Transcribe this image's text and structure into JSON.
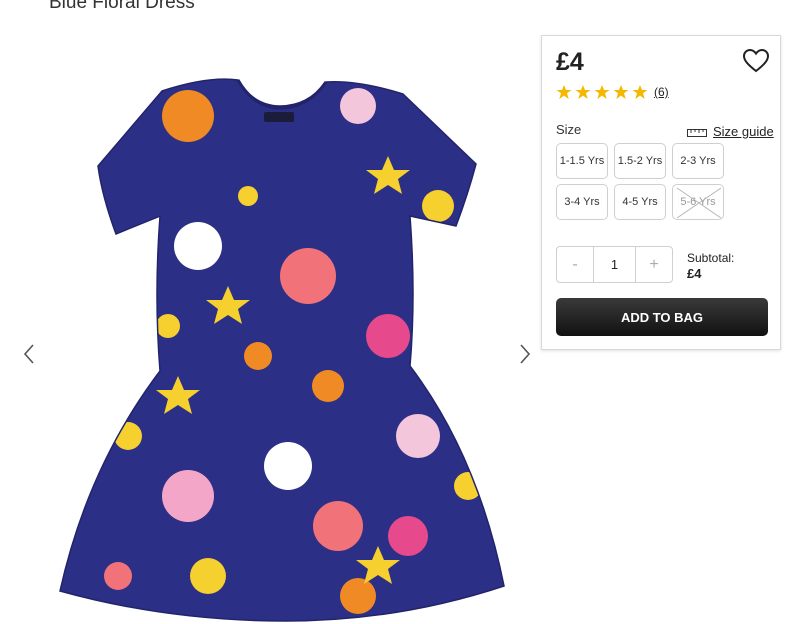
{
  "product": {
    "title": "Blue Floral Dress",
    "image_icon": "dress-photo"
  },
  "gallery": {
    "prev_icon": "chevron-left-icon",
    "next_icon": "chevron-right-icon"
  },
  "purchase": {
    "price": "£4",
    "wishlist_icon": "heart-icon",
    "rating": {
      "stars": 5,
      "out_of": 5,
      "count_label": "(6)",
      "star_color": "#f5b800"
    },
    "size_label": "Size",
    "size_guide_label": "Size guide",
    "sizes": [
      {
        "label": "1-1.5 Yrs",
        "available": true
      },
      {
        "label": "1.5-2 Yrs",
        "available": true
      },
      {
        "label": "2-3 Yrs",
        "available": true
      },
      {
        "label": "3-4 Yrs",
        "available": true
      },
      {
        "label": "4-5 Yrs",
        "available": true
      },
      {
        "label": "5-6 Yrs",
        "available": false
      }
    ],
    "quantity": {
      "minus": "-",
      "value": "1",
      "plus": "+"
    },
    "subtotal_label": "Subtotal:",
    "subtotal_value": "£4",
    "add_to_bag_label": "ADD TO BAG"
  },
  "colors": {
    "dress_navy": "#2c2f86",
    "button_dark": "#1a1a1a"
  }
}
